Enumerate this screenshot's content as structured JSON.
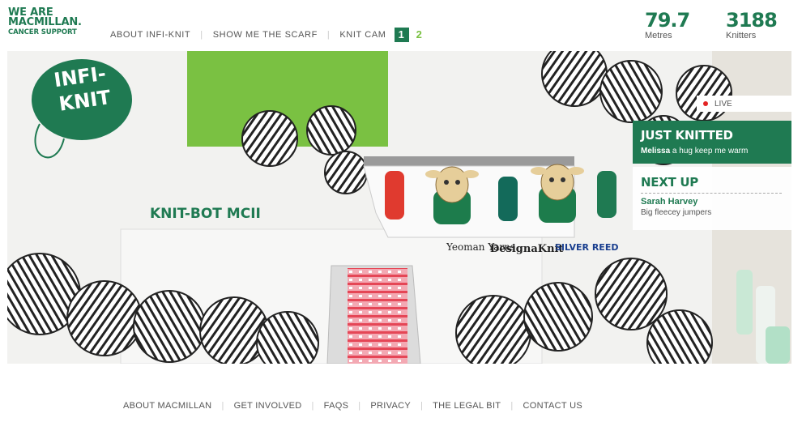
{
  "logo": {
    "line1": "WE ARE",
    "line2": "MACMILLAN.",
    "line3": "CANCER SUPPORT"
  },
  "nav": {
    "items": [
      "ABOUT INFI-KNIT",
      "SHOW ME THE SCARF",
      "KNIT CAM"
    ],
    "cam_buttons": [
      "1",
      "2"
    ]
  },
  "stats": {
    "metres_value": "79.7",
    "metres_label": "Metres",
    "knitters_value": "3188",
    "knitters_label": "Knitters"
  },
  "video_scene": {
    "wall_text": "INFI-\nKNIT",
    "machine_label": "KNIT-BOT MCII",
    "brands": [
      "Yeoman Yarns",
      "DesignaKnit",
      "SILVER REED"
    ]
  },
  "live": {
    "label": "LIVE"
  },
  "just_knitted": {
    "title": "JUST KNITTED",
    "name": "Melissa",
    "message": "a hug keep me warm"
  },
  "next_up": {
    "title": "NEXT UP",
    "name": "Sarah Harvey",
    "message": "Big fleecey jumpers"
  },
  "footer": {
    "links": [
      "ABOUT MACMILLAN",
      "GET INVOLVED",
      "FAQS",
      "PRIVACY",
      "THE LEGAL BIT",
      "CONTACT US"
    ]
  },
  "colors": {
    "brand_green": "#1f7a52",
    "lime": "#7ac142",
    "live_red": "#e32424"
  }
}
